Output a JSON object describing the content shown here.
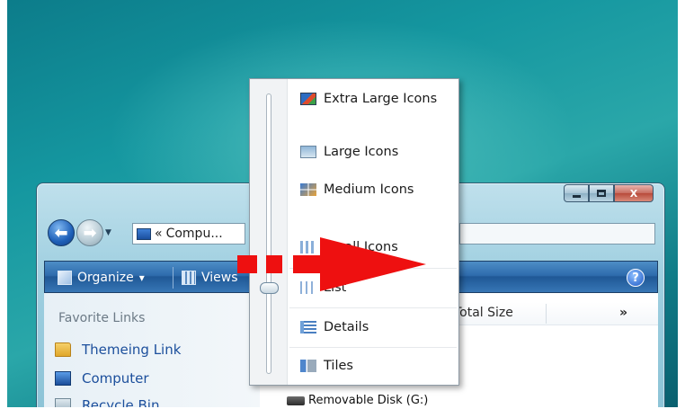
{
  "window": {
    "address_prefix": "«",
    "address_text": "Compu...",
    "caption_buttons": [
      "minimize",
      "maximize",
      "close"
    ],
    "close_label": "X"
  },
  "toolbar": {
    "organize_label": "Organize",
    "organize_arrow": "▾",
    "views_label": "Views",
    "help_label": "?"
  },
  "nav_pane": {
    "heading": "Favorite Links",
    "items": [
      {
        "label": "Themeing Link",
        "icon": "folder-icon"
      },
      {
        "label": "Computer",
        "icon": "computer-icon"
      },
      {
        "label": "Recycle Bin",
        "icon": "recycle-bin-icon"
      }
    ]
  },
  "file_list": {
    "columns": [
      "Total Size"
    ],
    "more_columns": "»",
    "rows": [
      {
        "name": "Removable Disk (G:)"
      }
    ]
  },
  "views_menu": {
    "items": [
      {
        "label": "Extra Large Icons",
        "icon": "extra-large-icons-icon"
      },
      {
        "label": "Large Icons",
        "icon": "large-icons-icon"
      },
      {
        "label": "Medium Icons",
        "icon": "medium-icons-icon"
      },
      {
        "label": "Small Icons",
        "icon": "small-icons-icon"
      },
      {
        "label": "List",
        "icon": "list-view-icon"
      },
      {
        "label": "Details",
        "icon": "details-view-icon"
      },
      {
        "label": "Tiles",
        "icon": "tiles-view-icon"
      }
    ],
    "slider_selected": "List"
  },
  "colors": {
    "toolbar_blue": "#2f6cad",
    "link_blue": "#1c4f9c",
    "annotation_red": "#ee1010",
    "desktop_teal": "#1597a0"
  }
}
